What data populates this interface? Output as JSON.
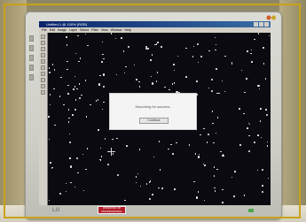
{
  "window": {
    "title": "Untitled-1 @ 100% (RGB)"
  },
  "menubar": {
    "items": [
      "File",
      "Edit",
      "Image",
      "Layer",
      "Select",
      "Filter",
      "View",
      "Window",
      "Help"
    ]
  },
  "dialog": {
    "message": "Searching for saucers...",
    "button_label": "Continue"
  },
  "monitor": {
    "brand": "LG",
    "sticker_line1": "WINDOWS XP",
    "sticker_line2": "PROFESSIONAL"
  },
  "colors": {
    "canvas": "#0a0a10",
    "dialog": "#f4f4f4",
    "frame": "#c8a21a",
    "titlebar": "#0a246a"
  }
}
